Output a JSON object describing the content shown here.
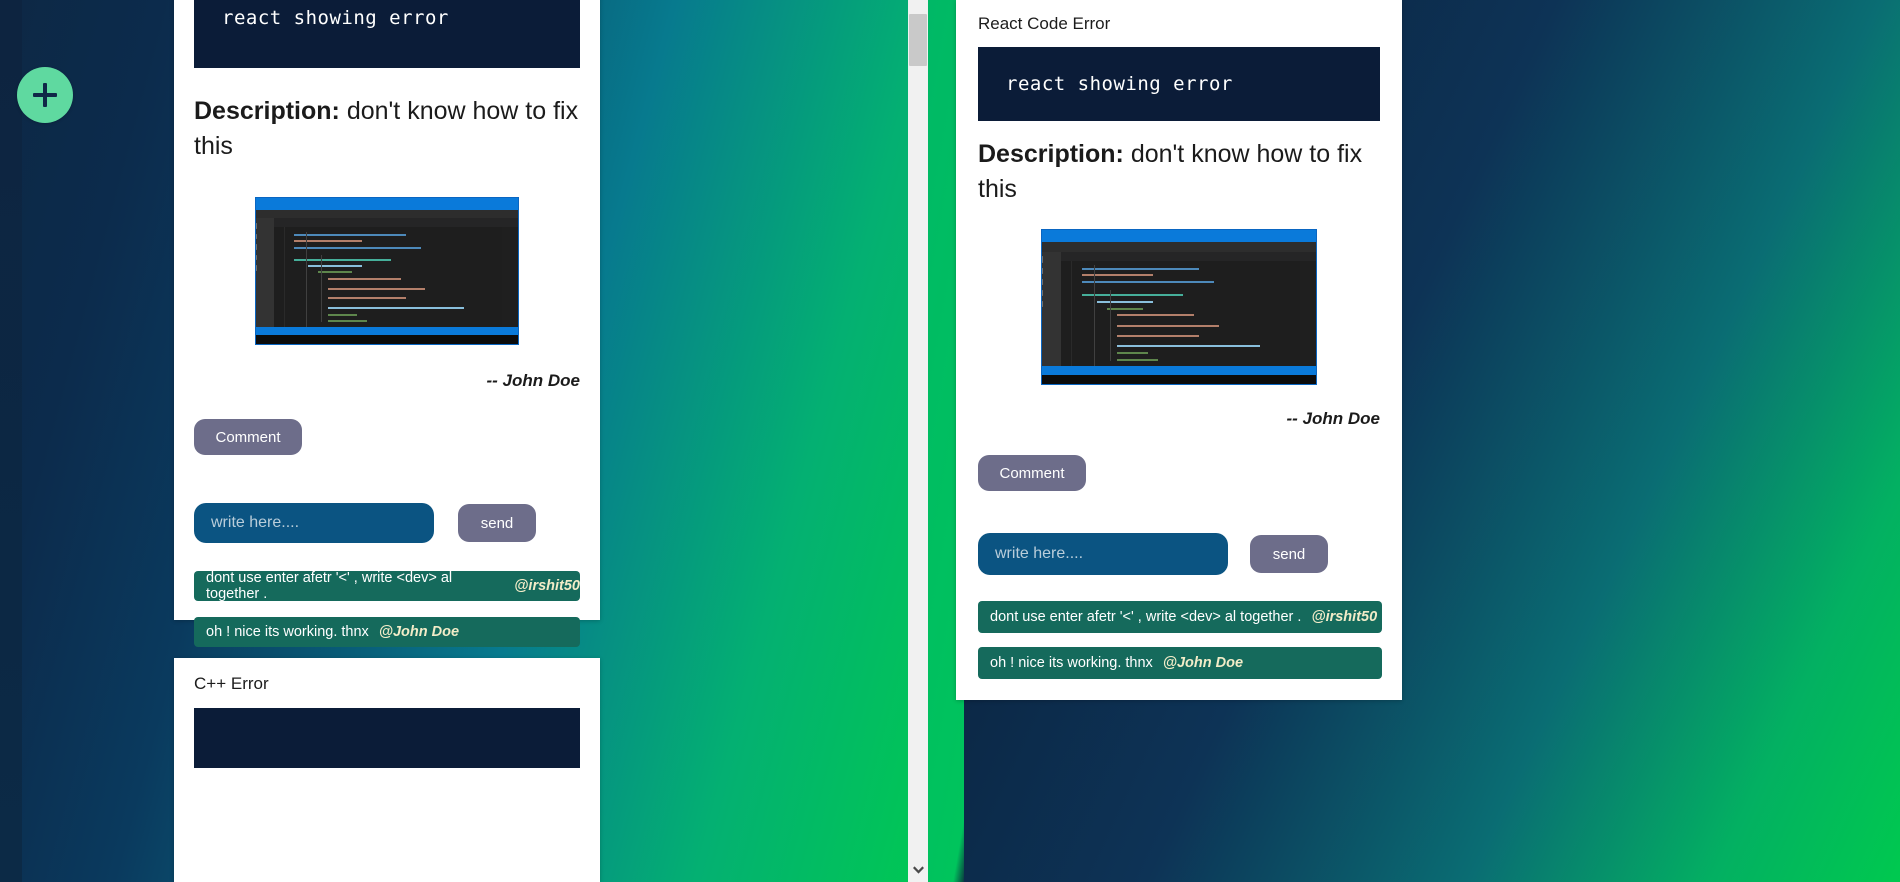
{
  "app": {
    "theme": {
      "accent_green": "#00c853",
      "fab_green": "#5fd9a0",
      "navy": "#0b1f3a",
      "code_banner_bg": "#0b1c38",
      "input_blue": "#0b5482",
      "button_gray": "#6d6d8a",
      "bubble_green": "#156a5c",
      "handle_cream": "#f2ecc8"
    },
    "fab_label": "+",
    "fab_icon": "plus-icon"
  },
  "scrollbar": {
    "down_arrow_icon": "chevron-down-icon",
    "down_arrow_glyph": "❯"
  },
  "left_pane": {
    "cards": [
      {
        "title": "",
        "code_title": "react showing error",
        "description_label": "Description:",
        "description_text": "don't know how to fix this",
        "author": "-- John Doe",
        "comment_button": "Comment",
        "input_placeholder": "write here....",
        "input_value": "",
        "send_button": "send",
        "screenshot_alt": "vscode-react-code-screenshot",
        "comments": [
          {
            "text": "dont use enter afetr '<' , write <dev> al together .",
            "handle": "@irshit50"
          },
          {
            "text": "oh ! nice its working. thnx",
            "handle": "@John Doe"
          }
        ]
      },
      {
        "title": "C++ Error",
        "code_title": "",
        "description_label": "",
        "description_text": "",
        "author": "",
        "comment_button": "",
        "input_placeholder": "",
        "send_button": "",
        "comments": []
      }
    ]
  },
  "right_pane": {
    "card": {
      "title": "React Code Error",
      "code_title": "react showing error",
      "description_label": "Description:",
      "description_text": "don't know how to fix this",
      "author": "-- John Doe",
      "comment_button": "Comment",
      "input_placeholder": "write here....",
      "input_value": "",
      "send_button": "send",
      "screenshot_alt": "vscode-react-code-screenshot",
      "comments": [
        {
          "text": "dont use enter afetr '<' , write <dev> al together .",
          "handle": "@irshit50"
        },
        {
          "text": "oh ! nice its working. thnx",
          "handle": "@John Doe"
        }
      ]
    }
  }
}
